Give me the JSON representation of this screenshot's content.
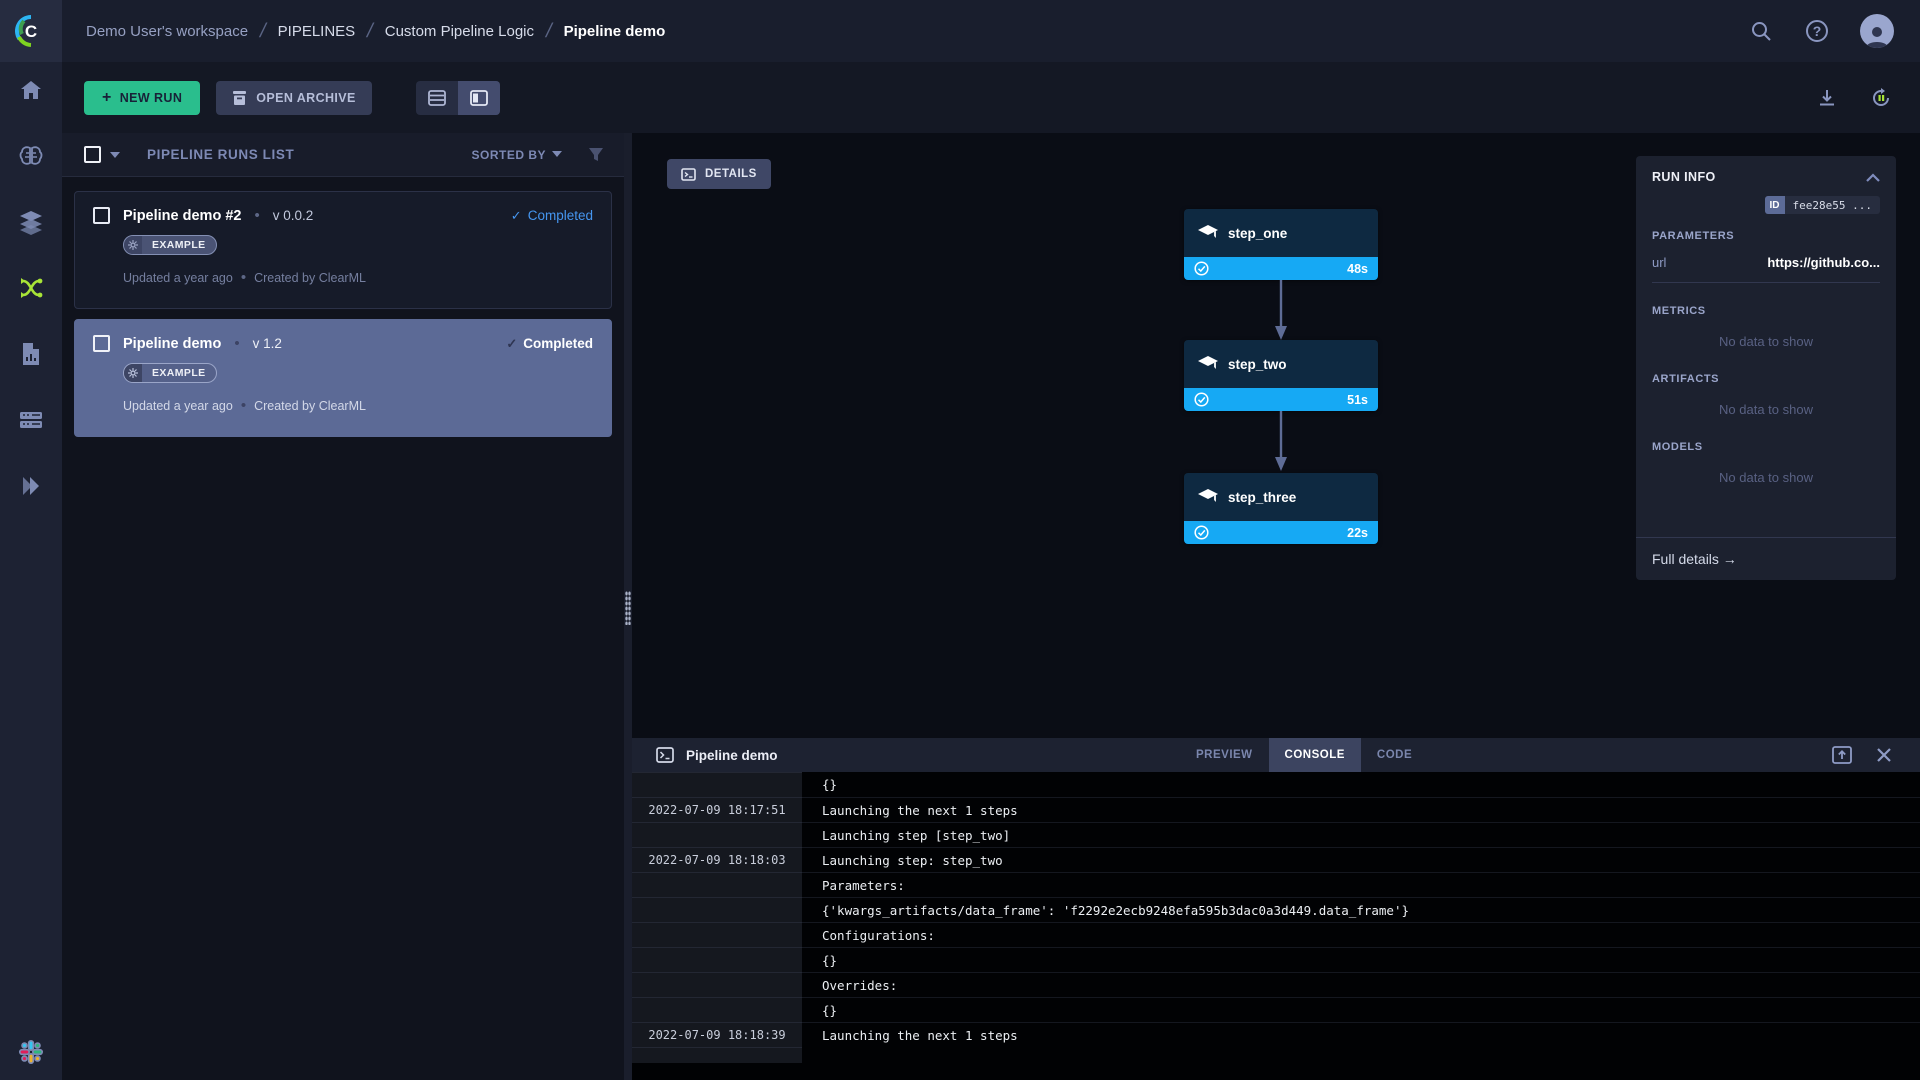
{
  "colors": {
    "accent_green": "#2abe8d",
    "accent_blue": "#16a9f4",
    "active_nav_green": "#a8e437",
    "selected_card": "#5c6a96",
    "status_blue": "#4596f0"
  },
  "header": {
    "breadcrumbs": [
      "Demo User's workspace",
      "PIPELINES",
      "Custom Pipeline Logic",
      "Pipeline demo"
    ],
    "help_glyph": "?"
  },
  "sidebar": {
    "items": [
      "home",
      "projects",
      "datasets",
      "pipelines",
      "reports",
      "workers-queues",
      "expand"
    ],
    "active_item": "pipelines"
  },
  "toolbar": {
    "new_run_label": "NEW RUN",
    "new_run_plus": "+",
    "open_archive_label": "OPEN ARCHIVE"
  },
  "runs_list": {
    "title": "PIPELINE RUNS LIST",
    "sorted_by_label": "SORTED BY",
    "check_glyph": "✓",
    "dot": "•",
    "runs": [
      {
        "name": "Pipeline demo #2",
        "version": "v 0.0.2",
        "status": "Completed",
        "tag": "EXAMPLE",
        "updated": "Updated a year ago",
        "created": "Created by ClearML"
      },
      {
        "name": "Pipeline demo",
        "version": "v 1.2",
        "status": "Completed",
        "tag": "EXAMPLE",
        "updated": "Updated a year ago",
        "created": "Created by ClearML"
      }
    ]
  },
  "graph": {
    "details_label": "DETAILS",
    "nodes": [
      {
        "name": "step_one",
        "duration": "48s"
      },
      {
        "name": "step_two",
        "duration": "51s"
      },
      {
        "name": "step_three",
        "duration": "22s"
      }
    ]
  },
  "run_info": {
    "title": "RUN INFO",
    "id_label": "ID",
    "id_value": "fee28e55 ...",
    "parameters_label": "PARAMETERS",
    "param_key": "url",
    "param_value": "https://github.co...",
    "metrics_label": "METRICS",
    "artifacts_label": "ARTIFACTS",
    "models_label": "MODELS",
    "empty_text": "No data to show",
    "full_details_label": "Full details →"
  },
  "console": {
    "title": "Pipeline demo",
    "tabs": [
      "PREVIEW",
      "CONSOLE",
      "CODE"
    ],
    "active_tab": "CONSOLE",
    "rows": [
      {
        "ts": "",
        "msg": "{}"
      },
      {
        "ts": "2022-07-09 18:17:51",
        "msg": "Launching the next 1 steps"
      },
      {
        "ts": "",
        "msg": "Launching step [step_two]"
      },
      {
        "ts": "2022-07-09 18:18:03",
        "msg": "Launching step: step_two"
      },
      {
        "ts": "",
        "msg": "Parameters:"
      },
      {
        "ts": "",
        "msg": "{'kwargs_artifacts/data_frame': 'f2292e2ecb9248efa595b3dac0a3d449.data_frame'}"
      },
      {
        "ts": "",
        "msg": "Configurations:"
      },
      {
        "ts": "",
        "msg": "{}"
      },
      {
        "ts": "",
        "msg": "Overrides:"
      },
      {
        "ts": "",
        "msg": "{}"
      },
      {
        "ts": "2022-07-09 18:18:39",
        "msg": "Launching the next 1 steps"
      }
    ]
  }
}
